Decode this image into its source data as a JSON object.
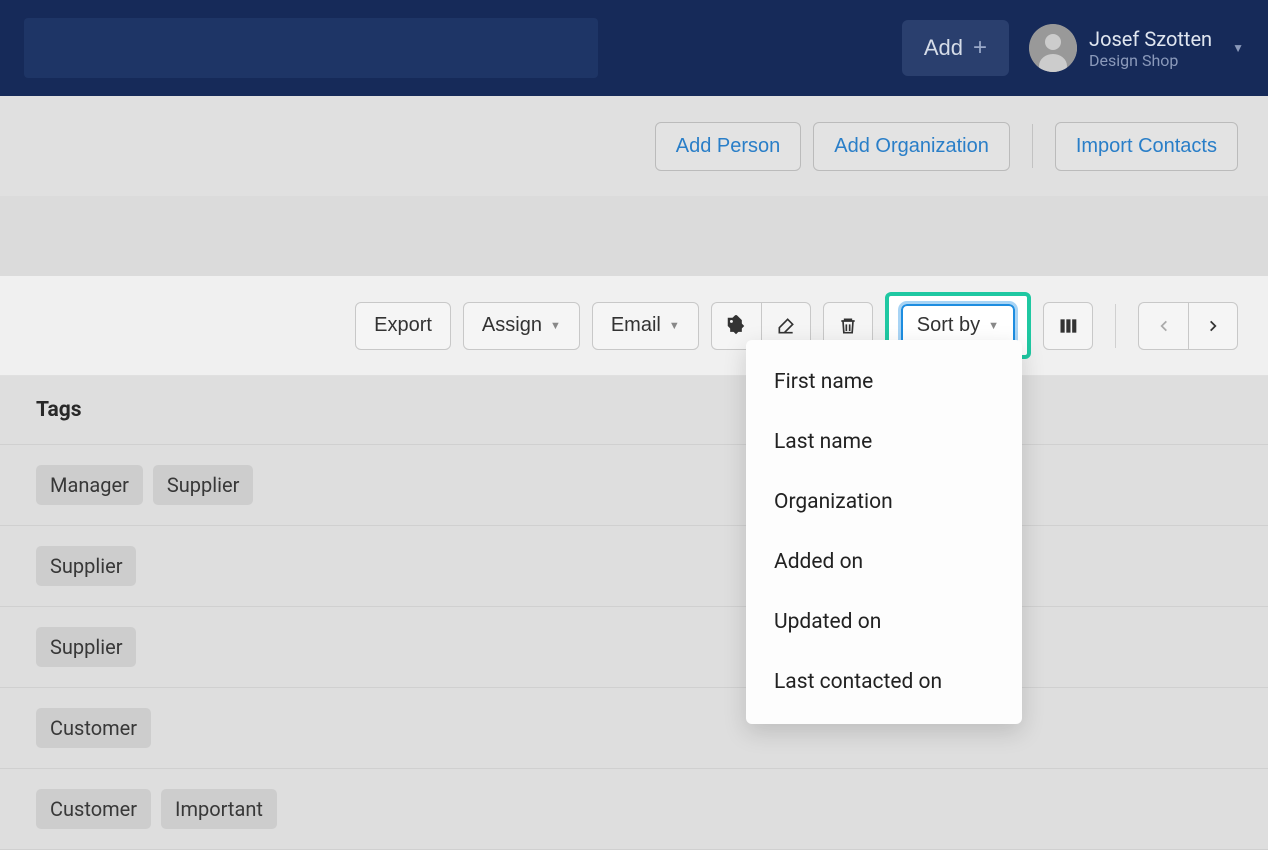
{
  "header": {
    "add_label": "Add",
    "user_name": "Josef Szotten",
    "user_org": "Design Shop"
  },
  "actions": {
    "add_person": "Add Person",
    "add_organization": "Add Organization",
    "import_contacts": "Import Contacts"
  },
  "toolbar": {
    "export": "Export",
    "assign": "Assign",
    "email": "Email",
    "sort_by": "Sort by"
  },
  "sort_options": [
    "First name",
    "Last name",
    "Organization",
    "Added on",
    "Updated on",
    "Last contacted on"
  ],
  "table": {
    "header": "Tags",
    "rows": [
      {
        "tags": [
          "Manager",
          "Supplier"
        ]
      },
      {
        "tags": [
          "Supplier"
        ]
      },
      {
        "tags": [
          "Supplier"
        ]
      },
      {
        "tags": [
          "Customer"
        ]
      },
      {
        "tags": [
          "Customer",
          "Important"
        ]
      }
    ]
  }
}
